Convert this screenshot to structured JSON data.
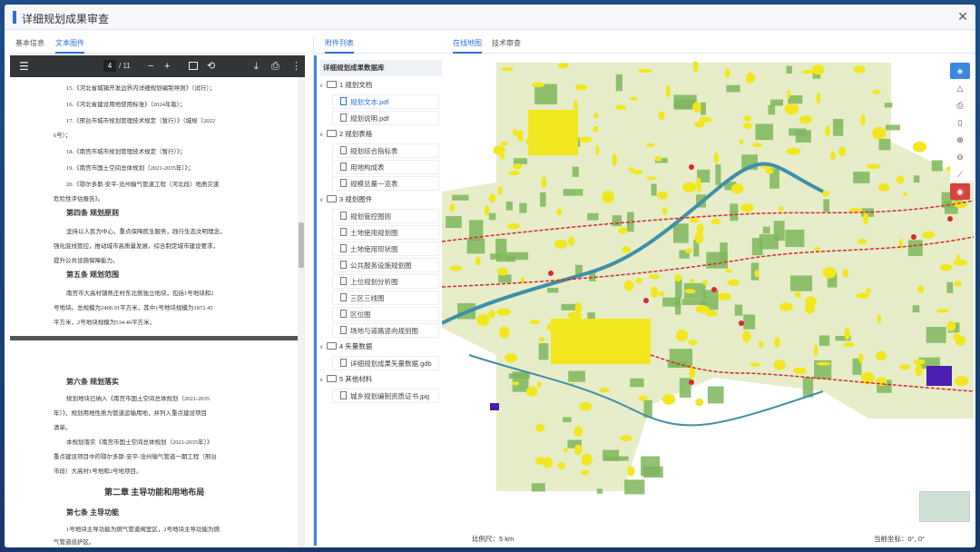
{
  "window": {
    "title": "详细规划成果审查"
  },
  "left_tabs": [
    {
      "label": "基本信息"
    },
    {
      "label": "文本图件"
    }
  ],
  "pdf": {
    "current_page": "4",
    "total_pages": "/ 11",
    "page1": {
      "lines": [
        "15.《河北省城镇开发边界内详细规划编制导则》（试行）；",
        "16.《河北省建设用地使用标准》（2024年版）；",
        "17.《邢台市城市规划管理技术规定（暂行）》（城规〔2022",
        "6号）；",
        "18.《南宫市城市规划管理技术规定（暂行）》；",
        "19.《南宫市国土空间总体规划（2021-2035年）》；",
        "20.《鄂尔多斯-安平-沧州输气管道工程（河北段）地质灾害",
        "危险性评估报告》。"
      ],
      "section4": {
        "heading": "第四条 规划原则",
        "lines": [
          "坚持以人民为中心，重点保障民生服务，践行生态文明理念，",
          "强化底线管控，推动城市高质量发展，综合制定城市建设要求，",
          "提升公共设施保障能力。"
        ]
      },
      "section5": {
        "heading": "第五条 规划范围",
        "lines": [
          "南宫市大高村镇焦庄村东北侧独立地块，包括1号地块和2",
          "号地块。总规模为2406.91平方米，其中1号地块规模为1872.45",
          "平方米，2号地块规模为534.46平方米。"
        ]
      }
    },
    "page2": {
      "section6": {
        "heading": "第六条 规划落实",
        "lines": [
          "规划地块已纳入《南宫市国土空间总体规划（2021-2035",
          "年）》，规划用地性质为管道运输用地，并列入重点建设项目",
          "清单。",
          "本规划落实《南宫市国土空间总体规划（2021-2035年）》",
          "重点建设项目中的鄂尔多斯-安平-沧州输气管道一期工程（邢台",
          "市段）大高村1号地和2号地项目。"
        ]
      },
      "chapter2": "第二章 主导功能和用地布局",
      "section7": {
        "heading": "第七条 主导功能",
        "lines": [
          "1号地块主导功能为燃气管道阀室区，2号地块主导功能为燃",
          "气管道巡护区。"
        ]
      }
    }
  },
  "file_tree": {
    "tab_label": "附件列表",
    "root": "详细规划成果数据库",
    "folders": [
      {
        "label": "1 规划文档",
        "files": [
          {
            "label": "规划文本.pdf",
            "active": true
          },
          {
            "label": "规划说明.pdf"
          }
        ]
      },
      {
        "label": "2 规划表格",
        "files": [
          {
            "label": "规划综合指标表"
          },
          {
            "label": "用地构成表"
          },
          {
            "label": "规模总量一览表"
          }
        ]
      },
      {
        "label": "3 规划图件",
        "files": [
          {
            "label": "规划管控图则"
          },
          {
            "label": "土地使用规划图"
          },
          {
            "label": "土地使用现状图"
          },
          {
            "label": "公共服务设施规划图"
          },
          {
            "label": "上位规划分析图"
          },
          {
            "label": "三区三线图"
          },
          {
            "label": "区位图"
          },
          {
            "label": "场地与道路竖向规划图"
          }
        ]
      },
      {
        "label": "4 矢量数据",
        "files": [
          {
            "label": "详细规划成果矢量数据.gdb"
          }
        ]
      },
      {
        "label": "5 其他材料",
        "files": [
          {
            "label": "城乡规划编制资质证书.jpg"
          }
        ]
      }
    ]
  },
  "right_tabs": [
    {
      "label": "在线地图"
    },
    {
      "label": "技术审查"
    }
  ],
  "map": {
    "scale_label": "比例尺：",
    "scale_value": "5 km",
    "coord_label": "当前坐标：",
    "coord_value": "0°, 0°",
    "tools": [
      "layers-icon",
      "bell-icon",
      "print-icon",
      "trash-icon",
      "zoom-in-icon",
      "zoom-out-icon",
      "measure-icon",
      "location-icon"
    ],
    "colors": {
      "farmland": "#e6edc8",
      "vegetation": "#7cb65c",
      "urban": "#f2e61f",
      "river": "#3f8fa8",
      "road": "#d9282e",
      "industrial": "#4a1fb0"
    }
  }
}
